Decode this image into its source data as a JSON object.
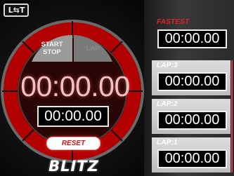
{
  "mode_button": {
    "label_left": "L",
    "label_arrow": "⇆",
    "label_right": "T"
  },
  "controls": {
    "start_line1": "START",
    "start_line2": "STOP",
    "lap": "LAP",
    "reset": "RESET"
  },
  "display": {
    "main_time": "00:00.00",
    "sub_time": "00:00.00"
  },
  "brand": "BLITZ",
  "laps": [
    {
      "label": "FASTEST",
      "time": "00:00.00"
    },
    {
      "label": "LAP:3",
      "time": "00:00.00"
    },
    {
      "label": "LAP:2",
      "time": "00:00.00"
    },
    {
      "label": "LAP:1",
      "time": "00:00.00"
    }
  ],
  "colors": {
    "accent": "#e01010",
    "fastest": "#e52222",
    "ring": "#b30000"
  }
}
